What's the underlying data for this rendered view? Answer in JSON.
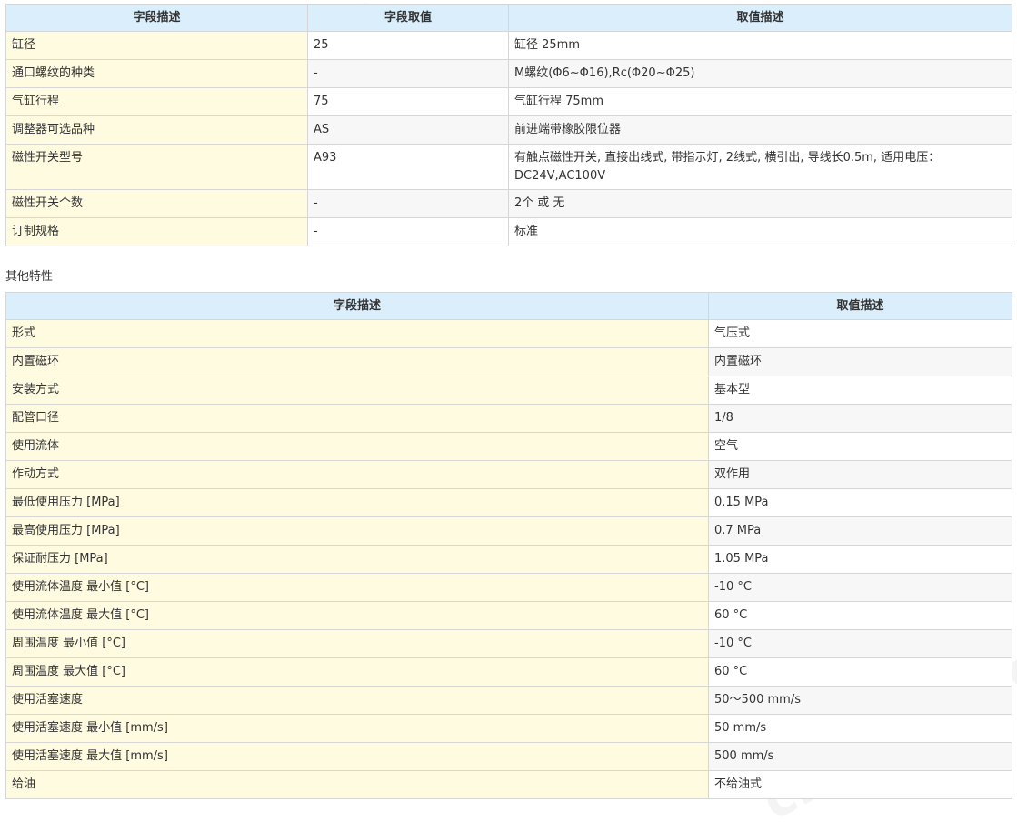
{
  "table1": {
    "headers": [
      "字段描述",
      "字段取值",
      "取值描述"
    ],
    "rows": [
      [
        "缸径",
        "25",
        "缸径 25mm"
      ],
      [
        "通口螺纹的种类",
        "-",
        "M螺纹(Φ6~Φ16),Rc(Φ20~Φ25)"
      ],
      [
        "气缸行程",
        "75",
        "气缸行程 75mm"
      ],
      [
        "调整器可选品种",
        "AS",
        "前进端带橡胶限位器"
      ],
      [
        "磁性开关型号",
        "A93",
        "有触点磁性开关, 直接出线式, 带指示灯, 2线式, 横引出, 导线长0.5m, 适用电压：DC24V,AC100V"
      ],
      [
        "磁性开关个数",
        "-",
        "2个 或 无"
      ],
      [
        "订制规格",
        "-",
        "标准"
      ]
    ]
  },
  "section_label": "其他特性",
  "table2": {
    "headers": [
      "字段描述",
      "取值描述"
    ],
    "rows": [
      [
        "形式",
        "气压式"
      ],
      [
        "内置磁环",
        "内置磁环"
      ],
      [
        "安装方式",
        "基本型"
      ],
      [
        "配管口径",
        "1/8"
      ],
      [
        "使用流体",
        "空气"
      ],
      [
        "作动方式",
        "双作用"
      ],
      [
        "最低使用压力 [MPa]",
        "0.15 MPa"
      ],
      [
        "最高使用压力 [MPa]",
        "0.7 MPa"
      ],
      [
        "保证耐压力 [MPa]",
        "1.05 MPa"
      ],
      [
        "使用流体温度 最小值 [°C]",
        "-10 °C"
      ],
      [
        "使用流体温度 最大值 [°C]",
        "60 °C"
      ],
      [
        "周围温度 最小值 [°C]",
        "-10 °C"
      ],
      [
        "周围温度 最大值 [°C]",
        "60 °C"
      ],
      [
        "使用活塞速度",
        "50～500 mm/s"
      ],
      [
        "使用活塞速度 最小值 [mm/s]",
        "50 mm/s"
      ],
      [
        "使用活塞速度 最大值 [mm/s]",
        "500 mm/s"
      ],
      [
        "给油",
        "不给油式"
      ]
    ]
  },
  "watermark": "chem17.com"
}
